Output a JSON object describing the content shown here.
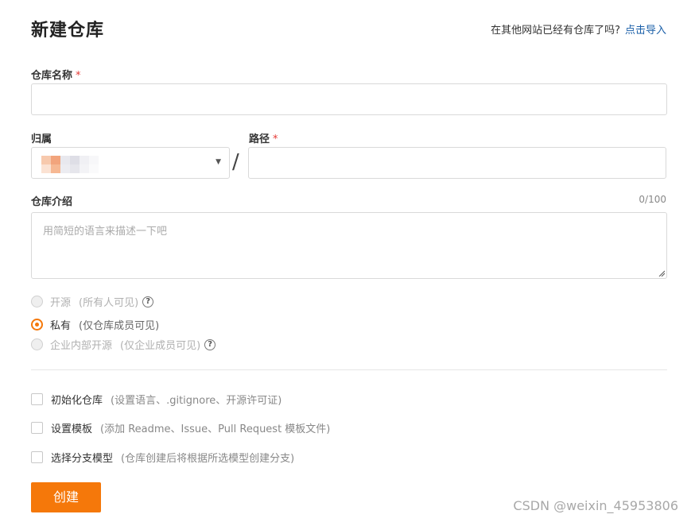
{
  "header": {
    "title": "新建仓库",
    "import_hint": "在其他网站已经有仓库了吗?",
    "import_link": "点击导入"
  },
  "form": {
    "name_label": "仓库名称",
    "required_mark": "*",
    "owner_label": "归属",
    "path_label": "路径",
    "separator": "/",
    "description_label": "仓库介绍",
    "description_counter": "0/100",
    "description_placeholder": "用简短的语言来描述一下吧"
  },
  "visibility": [
    {
      "label": "开源",
      "hint": "(所有人可见)",
      "state": "disabled",
      "help": "?"
    },
    {
      "label": "私有",
      "hint": "(仅仓库成员可见)",
      "state": "selected"
    },
    {
      "label": "企业内部开源",
      "hint": "(仅企业成员可见)",
      "state": "disabled",
      "help": "?"
    }
  ],
  "options": [
    {
      "label": "初始化仓库",
      "hint": "(设置语言、.gitignore、开源许可证)"
    },
    {
      "label": "设置模板",
      "hint": "(添加 Readme、Issue、Pull Request 模板文件)"
    },
    {
      "label": "选择分支模型",
      "hint": "(仓库创建后将根据所选模型创建分支)"
    }
  ],
  "submit_label": "创建",
  "watermark": "CSDN @weixin_45953806",
  "colors": {
    "accent": "#f5780a",
    "link": "#1a5fa8",
    "required": "#e53935"
  }
}
